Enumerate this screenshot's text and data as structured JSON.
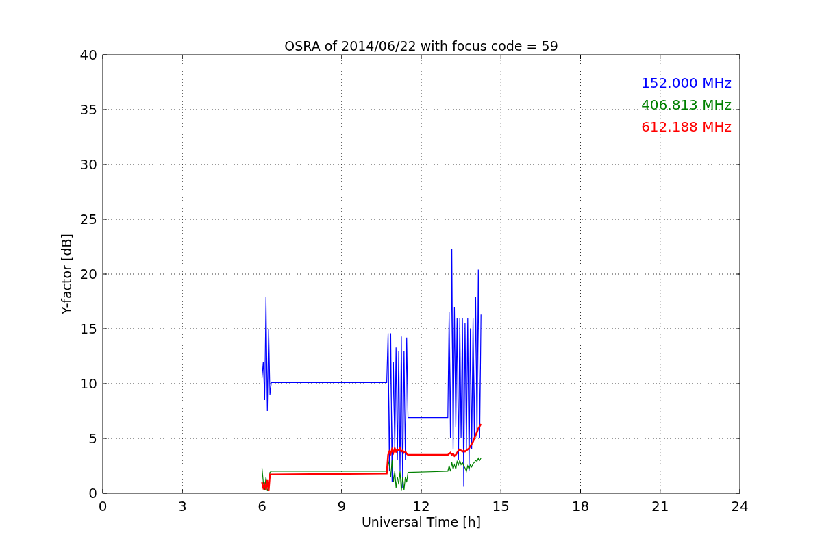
{
  "figure": {
    "chart_data": {
      "type": "line",
      "title": "OSRA of 2014/06/22 with focus code = 59",
      "xlabel": "Universal Time [h]",
      "ylabel": "Y-factor [dB]",
      "xlim": [
        0,
        24
      ],
      "ylim": [
        0,
        40
      ],
      "grid": true,
      "xticks": [
        0,
        3,
        6,
        9,
        12,
        15,
        18,
        21,
        24
      ],
      "yticks": [
        0,
        5,
        10,
        15,
        20,
        25,
        30,
        35,
        40
      ],
      "x": [
        6.0,
        6.05,
        6.1,
        6.15,
        6.2,
        6.25,
        6.3,
        6.35,
        10.7,
        10.75,
        10.8,
        10.85,
        10.9,
        10.95,
        11.0,
        11.05,
        11.1,
        11.15,
        11.2,
        11.25,
        11.3,
        11.35,
        11.4,
        11.45,
        11.5,
        13.0,
        13.05,
        13.1,
        13.15,
        13.2,
        13.25,
        13.3,
        13.35,
        13.4,
        13.45,
        13.5,
        13.55,
        13.6,
        13.65,
        13.7,
        13.75,
        13.8,
        13.85,
        13.9,
        13.95,
        14.0,
        14.05,
        14.1,
        14.15,
        14.2,
        14.25
      ],
      "series": [
        {
          "name": "152.000 MHz",
          "color": "#0000ff",
          "values": [
            10.5,
            12,
            8.5,
            17.9,
            7.5,
            15,
            9,
            10.1,
            10.1,
            14.6,
            2,
            14.6,
            1,
            12,
            4,
            13.3,
            3,
            13,
            2,
            14.3,
            0.5,
            13,
            3,
            14.2,
            6.9,
            6.9,
            16.5,
            5,
            22.3,
            4,
            17,
            6,
            16,
            3,
            16,
            5,
            16,
            0.6,
            15.5,
            4,
            16,
            2,
            15,
            4,
            16,
            5,
            17.9,
            5,
            20.4,
            5,
            16.3
          ]
        },
        {
          "name": "406.813 MHz",
          "color": "#008000",
          "values": [
            2.3,
            1,
            0.3,
            1.5,
            0.2,
            0.5,
            1.9,
            2.0,
            2.0,
            3.0,
            2.5,
            1.5,
            3,
            1,
            2,
            0.5,
            1.5,
            0.8,
            2,
            0.2,
            1.5,
            0.3,
            1.5,
            1,
            1.9,
            2.0,
            2.5,
            2,
            2.8,
            2.2,
            2.6,
            2.2,
            2.9,
            2.6,
            3,
            2.6,
            2.8,
            2.5,
            2.3,
            2.0,
            2.5,
            2.2,
            2.6,
            2.4,
            2.7,
            2.8,
            3.0,
            2.9,
            3.2,
            3.0,
            3.2
          ]
        },
        {
          "name": "612.188 MHz",
          "color": "#ff0000",
          "values": [
            1,
            0.5,
            0.8,
            0.3,
            1.2,
            0.2,
            1.7,
            1.7,
            1.8,
            3.5,
            3.8,
            3.6,
            4,
            3.7,
            4.1,
            3.8,
            4.0,
            3.9,
            4.1,
            3.8,
            3.9,
            3.7,
            3.8,
            3.6,
            3.5,
            3.5,
            3.6,
            3.7,
            3.5,
            3.6,
            3.4,
            3.5,
            3.7,
            3.9,
            4.0,
            3.9,
            3.8,
            3.9,
            3.8,
            3.9,
            4.0,
            4.1,
            4.3,
            4.5,
            4.7,
            5.0,
            5.3,
            5.6,
            5.9,
            6.1,
            6.3
          ]
        }
      ]
    }
  }
}
